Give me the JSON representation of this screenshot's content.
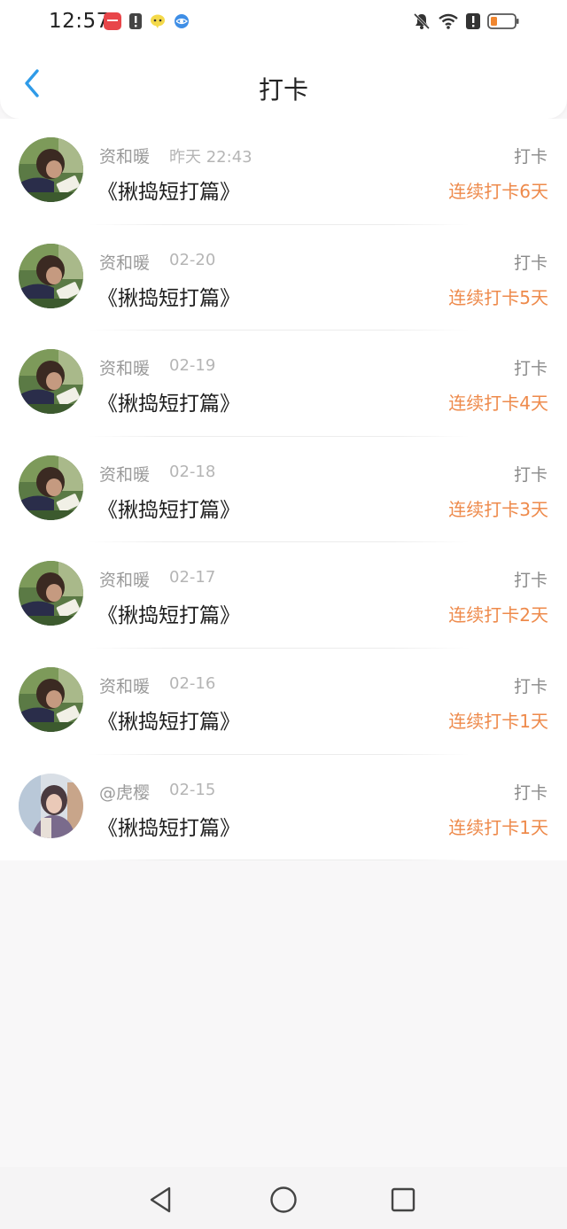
{
  "status_bar": {
    "time": "12:57",
    "left_icons": [
      "app-red-icon",
      "notification-alert-icon",
      "chat-app-icon",
      "browser-app-icon"
    ],
    "right_icons": [
      "bell-muted-icon",
      "wifi-icon",
      "alert-icon",
      "battery-low-icon"
    ]
  },
  "nav": {
    "title": "打卡",
    "back_icon": "chevron-left-icon"
  },
  "colors": {
    "accent_blue": "#2f9be8",
    "streak_orange": "#ee8a4b",
    "battery_orange": "#f0862f"
  },
  "items": [
    {
      "user": "资和暖",
      "time": "昨天 22:43",
      "title": "《揪捣短打篇》",
      "action": "打卡",
      "streak": "连续打卡6天",
      "avatar": "avatar-reader"
    },
    {
      "user": "资和暖",
      "time": "02-20",
      "title": "《揪捣短打篇》",
      "action": "打卡",
      "streak": "连续打卡5天",
      "avatar": "avatar-reader"
    },
    {
      "user": "资和暖",
      "time": "02-19",
      "title": "《揪捣短打篇》",
      "action": "打卡",
      "streak": "连续打卡4天",
      "avatar": "avatar-reader"
    },
    {
      "user": "资和暖",
      "time": "02-18",
      "title": "《揪捣短打篇》",
      "action": "打卡",
      "streak": "连续打卡3天",
      "avatar": "avatar-reader"
    },
    {
      "user": "资和暖",
      "time": "02-17",
      "title": "《揪捣短打篇》",
      "action": "打卡",
      "streak": "连续打卡2天",
      "avatar": "avatar-reader"
    },
    {
      "user": "资和暖",
      "time": "02-16",
      "title": "《揪捣短打篇》",
      "action": "打卡",
      "streak": "连续打卡1天",
      "avatar": "avatar-reader"
    },
    {
      "user": "@虎樱",
      "time": "02-15",
      "title": "《揪捣短打篇》",
      "action": "打卡",
      "streak": "连续打卡1天",
      "avatar": "avatar-girl"
    }
  ],
  "system_nav": [
    "back-triangle-icon",
    "home-circle-icon",
    "recents-square-icon"
  ]
}
